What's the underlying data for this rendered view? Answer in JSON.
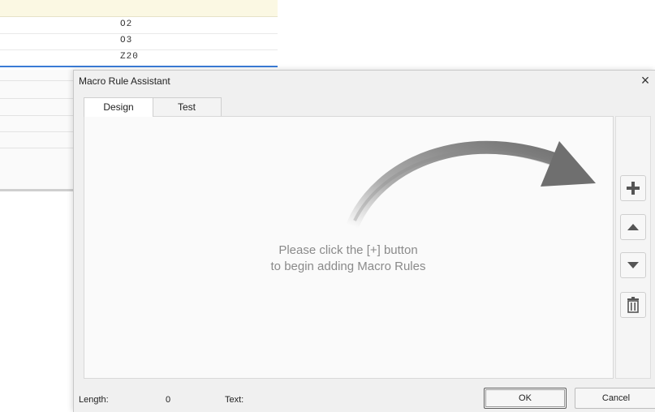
{
  "background_list": {
    "rows": [
      "O2",
      "O3",
      "Z20"
    ]
  },
  "dialog": {
    "title": "Macro Rule Assistant",
    "close_symbol": "×",
    "tabs": [
      {
        "label": "Design",
        "selected": true
      },
      {
        "label": "Test",
        "selected": false
      }
    ],
    "design_panel": {
      "message_line1": "Please click the [+] button",
      "message_line2": "to begin adding Macro Rules"
    },
    "toolbar": {
      "icons": [
        "plus-icon",
        "arrow-up-icon",
        "arrow-down-icon",
        "trash-icon"
      ]
    },
    "footer": {
      "length_label": "Length:",
      "length_value": "0",
      "text_label": "Text:",
      "ok_label": "OK",
      "cancel_label": "Cancel"
    }
  },
  "colors": {
    "dialog_bg": "#f0f0f0",
    "panel_bg": "#fafafa",
    "hint_text": "#8a8a8a",
    "arrow": "#6f6f6f",
    "selection_underline": "#3a7bd5",
    "header_row": "#fbf8e3"
  }
}
